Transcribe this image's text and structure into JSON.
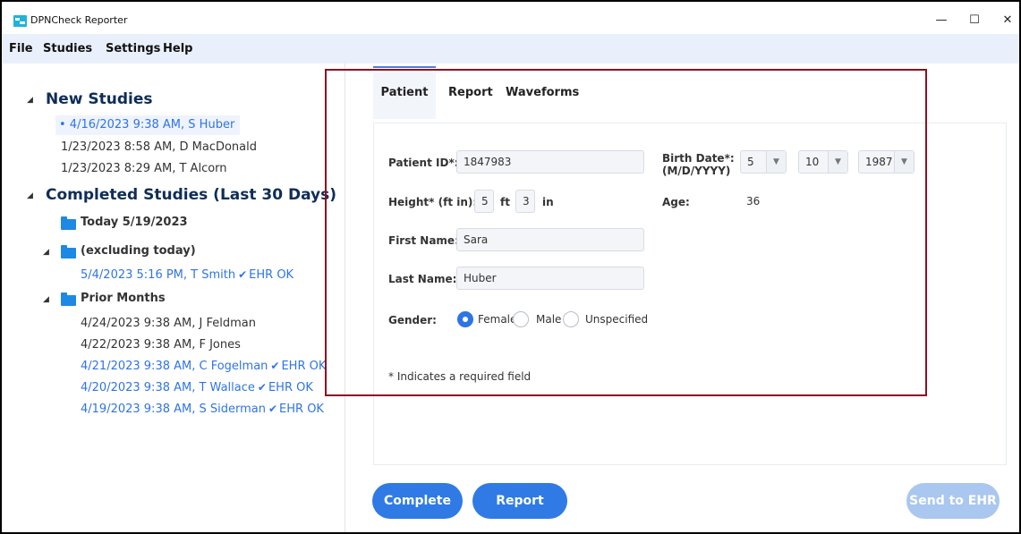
{
  "window": {
    "title": "DPNCheck Reporter",
    "minimize": "—",
    "maximize": "☐",
    "close": "✕",
    "accent_color": "#2f7ae5",
    "highlight_color": "#8a1220"
  },
  "menu": [
    "File",
    "Studies",
    "Settings",
    "Help"
  ],
  "sidebar": {
    "new_studies": {
      "heading": "New Studies",
      "items": [
        "• 4/16/2023 9:38 AM, S Huber",
        "1/23/2023 8:58 AM, D MacDonald",
        "1/23/2023 8:29 AM, T Alcorn"
      ]
    },
    "completed": {
      "heading": "Completed Studies (Last 30 Days)",
      "today": "Today 5/19/2023",
      "excluding": {
        "label": "(excluding today)",
        "items": [
          {
            "text": "5/4/2023 5:16 PM, T Smith",
            "status": "EHR OK"
          }
        ]
      },
      "prior": {
        "label": "Prior Months",
        "items": [
          {
            "text": "4/24/2023 9:38 AM, J Feldman",
            "status": ""
          },
          {
            "text": "4/22/2023 9:38 AM, F Jones",
            "status": ""
          },
          {
            "text": "4/21/2023 9:38 AM, C Fogelman",
            "status": "EHR OK"
          },
          {
            "text": "4/20/2023 9:38 AM, T Wallace",
            "status": "EHR OK"
          },
          {
            "text": "4/19/2023 9:38 AM, S Siderman",
            "status": "EHR OK"
          }
        ]
      }
    }
  },
  "tabs": [
    "Patient",
    "Report",
    "Waveforms"
  ],
  "form": {
    "patient_id_label": "Patient ID*:",
    "patient_id": "1847983",
    "birth_date_label": "Birth Date*:",
    "birth_date_format": "(M/D/YYYY)",
    "birth_month": "5",
    "birth_day": "10",
    "birth_year": "1987",
    "height_label": "Height* (ft in):",
    "height_ft": "5",
    "ft_unit": "ft",
    "height_in": "3",
    "in_unit": "in",
    "age_label": "Age:",
    "age": "36",
    "first_name_label": "First Name:",
    "first_name": "Sara",
    "last_name_label": "Last Name:",
    "last_name": "Huber",
    "gender_label": "Gender:",
    "gender_options": [
      "Female",
      "Male",
      "Unspecified"
    ],
    "gender_selected": "Female",
    "required_note": "* Indicates a required field"
  },
  "buttons": {
    "complete": "Complete",
    "report": "Report",
    "send_to_ehr": "Send to EHR"
  }
}
